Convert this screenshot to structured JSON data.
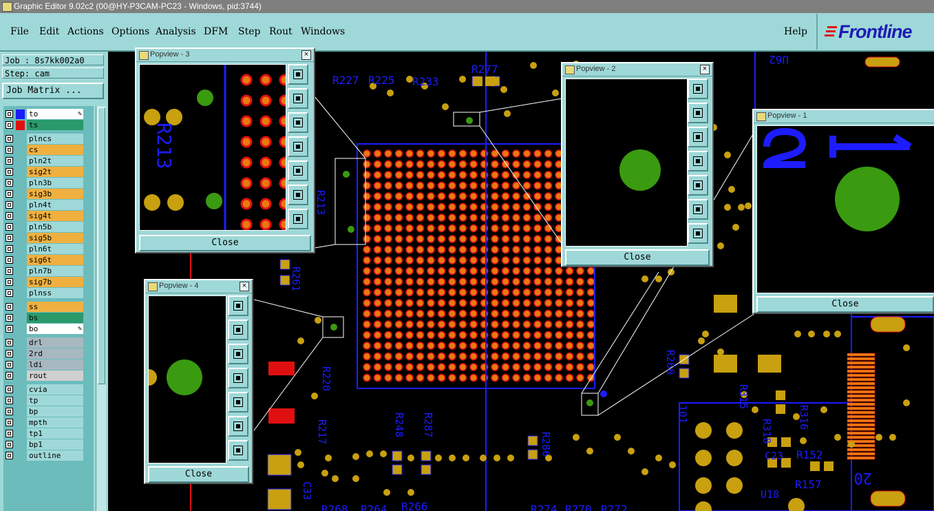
{
  "window": {
    "title": "Graphic Editor 9.02c2 (00@HY-P3CAM-PC23 - Windows, pid:3744)"
  },
  "menu": {
    "items": [
      "File",
      "Edit",
      "Actions",
      "Options",
      "Analysis",
      "DFM",
      "Step",
      "Rout",
      "Windows"
    ],
    "help": "Help",
    "logo": "Frontline"
  },
  "job_panel": {
    "job": "Job : 8s7kk002a0",
    "step": "Step: cam",
    "matrix_button": "Job Matrix ..."
  },
  "layers": [
    {
      "name": "to",
      "color": "#1c1cff",
      "label_bg": "#ffffff",
      "edit": true
    },
    {
      "name": "ts",
      "color": "#e01010",
      "label_bg": "#2a9a6a",
      "edit": false
    },
    {
      "name": "plncs",
      "color": "",
      "label_bg": "#9fd8d8",
      "edit": false
    },
    {
      "name": "cs",
      "color": "",
      "label_bg": "#f0b040",
      "edit": false
    },
    {
      "name": "pln2t",
      "color": "",
      "label_bg": "#9fd8d8",
      "edit": false
    },
    {
      "name": "sig2t",
      "color": "",
      "label_bg": "#f0b040",
      "edit": false
    },
    {
      "name": "pln3b",
      "color": "",
      "label_bg": "#9fd8d8",
      "edit": false
    },
    {
      "name": "sig3b",
      "color": "",
      "label_bg": "#f0b040",
      "edit": false
    },
    {
      "name": "pln4t",
      "color": "",
      "label_bg": "#9fd8d8",
      "edit": false
    },
    {
      "name": "sig4t",
      "color": "",
      "label_bg": "#f0b040",
      "edit": false
    },
    {
      "name": "pln5b",
      "color": "",
      "label_bg": "#9fd8d8",
      "edit": false
    },
    {
      "name": "sig5b",
      "color": "",
      "label_bg": "#f0b040",
      "edit": false
    },
    {
      "name": "pln6t",
      "color": "",
      "label_bg": "#9fd8d8",
      "edit": false
    },
    {
      "name": "sig6t",
      "color": "",
      "label_bg": "#f0b040",
      "edit": false
    },
    {
      "name": "pln7b",
      "color": "",
      "label_bg": "#9fd8d8",
      "edit": false
    },
    {
      "name": "sig7b",
      "color": "",
      "label_bg": "#f0b040",
      "edit": false
    },
    {
      "name": "plnss",
      "color": "",
      "label_bg": "#9fd8d8",
      "edit": false
    },
    {
      "name": "ss",
      "color": "",
      "label_bg": "#f0b040",
      "edit": false
    },
    {
      "name": "bs",
      "color": "",
      "label_bg": "#2a9a6a",
      "edit": false
    },
    {
      "name": "bo",
      "color": "",
      "label_bg": "#ffffff",
      "edit": true
    },
    {
      "name": "drl",
      "color": "",
      "label_bg": "#a8b8c0",
      "edit": false
    },
    {
      "name": "2rd",
      "color": "",
      "label_bg": "#a8b8c0",
      "edit": false
    },
    {
      "name": "ldi",
      "color": "",
      "label_bg": "#a8b8c0",
      "edit": false
    },
    {
      "name": "rout",
      "color": "",
      "label_bg": "#d0d0d0",
      "edit": false
    },
    {
      "name": "cvia",
      "color": "",
      "label_bg": "#9fd8d8",
      "edit": false
    },
    {
      "name": "tp",
      "color": "",
      "label_bg": "#9fd8d8",
      "edit": false
    },
    {
      "name": "bp",
      "color": "",
      "label_bg": "#9fd8d8",
      "edit": false
    },
    {
      "name": "mpth",
      "color": "",
      "label_bg": "#9fd8d8",
      "edit": false
    },
    {
      "name": "tp1",
      "color": "",
      "label_bg": "#9fd8d8",
      "edit": false
    },
    {
      "name": "bp1",
      "color": "",
      "label_bg": "#9fd8d8",
      "edit": false
    },
    {
      "name": "outline",
      "color": "",
      "label_bg": "#9fd8d8",
      "edit": false
    }
  ],
  "popviews": {
    "p3": {
      "title": "Popview - 3",
      "close": "Close"
    },
    "p2": {
      "title": "Popview - 2",
      "close": "Close"
    },
    "p1": {
      "title": "Popview - 1",
      "close": "Close"
    },
    "p4": {
      "title": "Popview - 4",
      "close": "Close"
    }
  },
  "board_labels": {
    "r227": "R227",
    "r225": "R225",
    "r233": "R233",
    "r277": "R277",
    "u62": "U62",
    "r261": "R261",
    "r260": "R260",
    "r220": "R220",
    "r217": "R217",
    "r248": "R248",
    "r287": "R287",
    "r286": "R286",
    "r318": "R318",
    "r316": "R316",
    "r315": "R315",
    "r152": "R152",
    "r157": "R157",
    "r266": "R266",
    "r268": "R268",
    "r264": "R264",
    "r274": "R274",
    "r270": "R270",
    "r272": "R272",
    "c33": "C33",
    "u18": "U18",
    "c23": "C23",
    "n20": "20",
    "r213": "R213",
    "n101": "101"
  },
  "colors": {
    "trace": "#1c1cff",
    "pad_gold": "#c8a010",
    "via_green": "#3a9a10",
    "ball_red": "#e01010",
    "ball_orange": "#e87a10",
    "ui_bg": "#9fd8d8"
  }
}
